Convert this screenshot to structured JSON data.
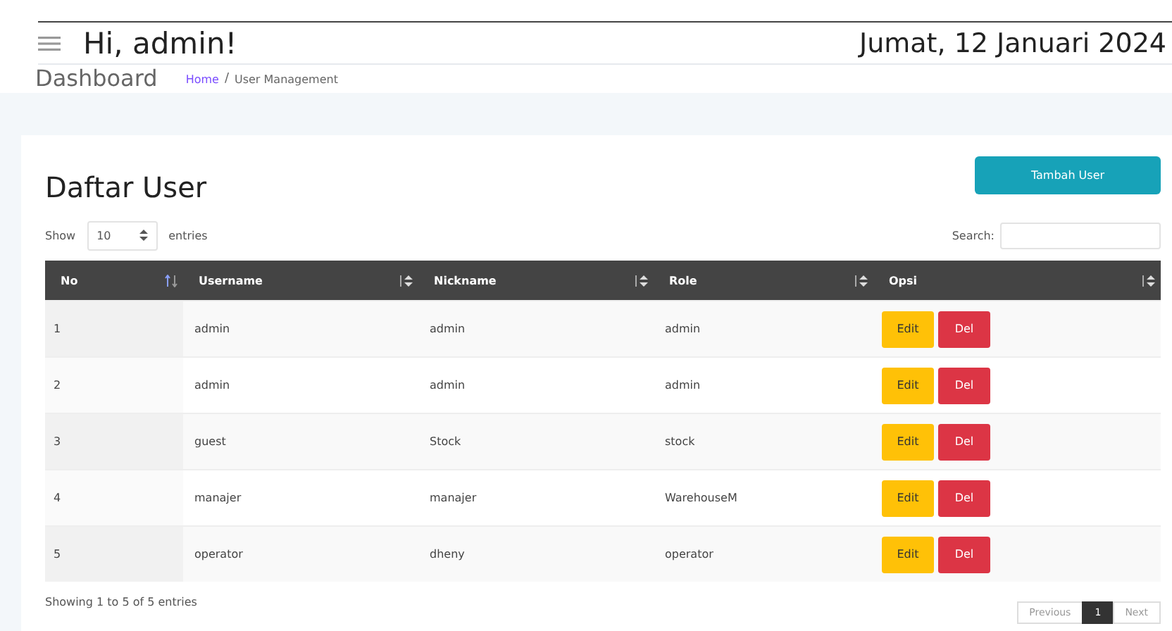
{
  "header": {
    "greeting": "Hi, admin!",
    "date": "Jumat, 12 Januari 2024"
  },
  "page_title": "Dashboard",
  "breadcrumb": [
    {
      "label": "Home",
      "kind": "link"
    },
    {
      "label": "/",
      "kind": "separator"
    },
    {
      "label": "User Management",
      "kind": "current"
    }
  ],
  "card": {
    "title": "Daftar User",
    "add_button": "Tambah User",
    "length": {
      "prefix": "Show",
      "value": "10",
      "suffix": "entries"
    },
    "search": {
      "label": "Search:"
    },
    "table": {
      "columns": [
        {
          "label": "No",
          "sorted": true
        },
        {
          "label": "Username",
          "sorted": false
        },
        {
          "label": "Nickname",
          "sorted": false
        },
        {
          "label": "Role",
          "sorted": false
        },
        {
          "label": "Opsi",
          "sorted": false
        }
      ],
      "rows": [
        {
          "no": "1",
          "username": "admin",
          "nickname": "admin",
          "role": "admin",
          "actions": [
            "Edit",
            "Del"
          ]
        },
        {
          "no": "2",
          "username": "admin",
          "nickname": "admin",
          "role": "admin",
          "actions": [
            "Edit",
            "Del"
          ]
        },
        {
          "no": "3",
          "username": "guest",
          "nickname": "Stock",
          "role": "stock",
          "actions": [
            "Edit",
            "Del"
          ]
        },
        {
          "no": "4",
          "username": "manajer",
          "nickname": "manajer",
          "role": "WarehouseM",
          "actions": [
            "Edit",
            "Del"
          ]
        },
        {
          "no": "5",
          "username": "operator",
          "nickname": "dheny",
          "role": "operator",
          "actions": [
            "Edit",
            "Del"
          ]
        }
      ]
    },
    "info": "Showing 1 to 5 of 5 entries",
    "pagination": [
      {
        "label": "Previous",
        "selected": false
      },
      {
        "label": "1",
        "selected": true
      },
      {
        "label": "Next",
        "selected": false
      }
    ]
  }
}
